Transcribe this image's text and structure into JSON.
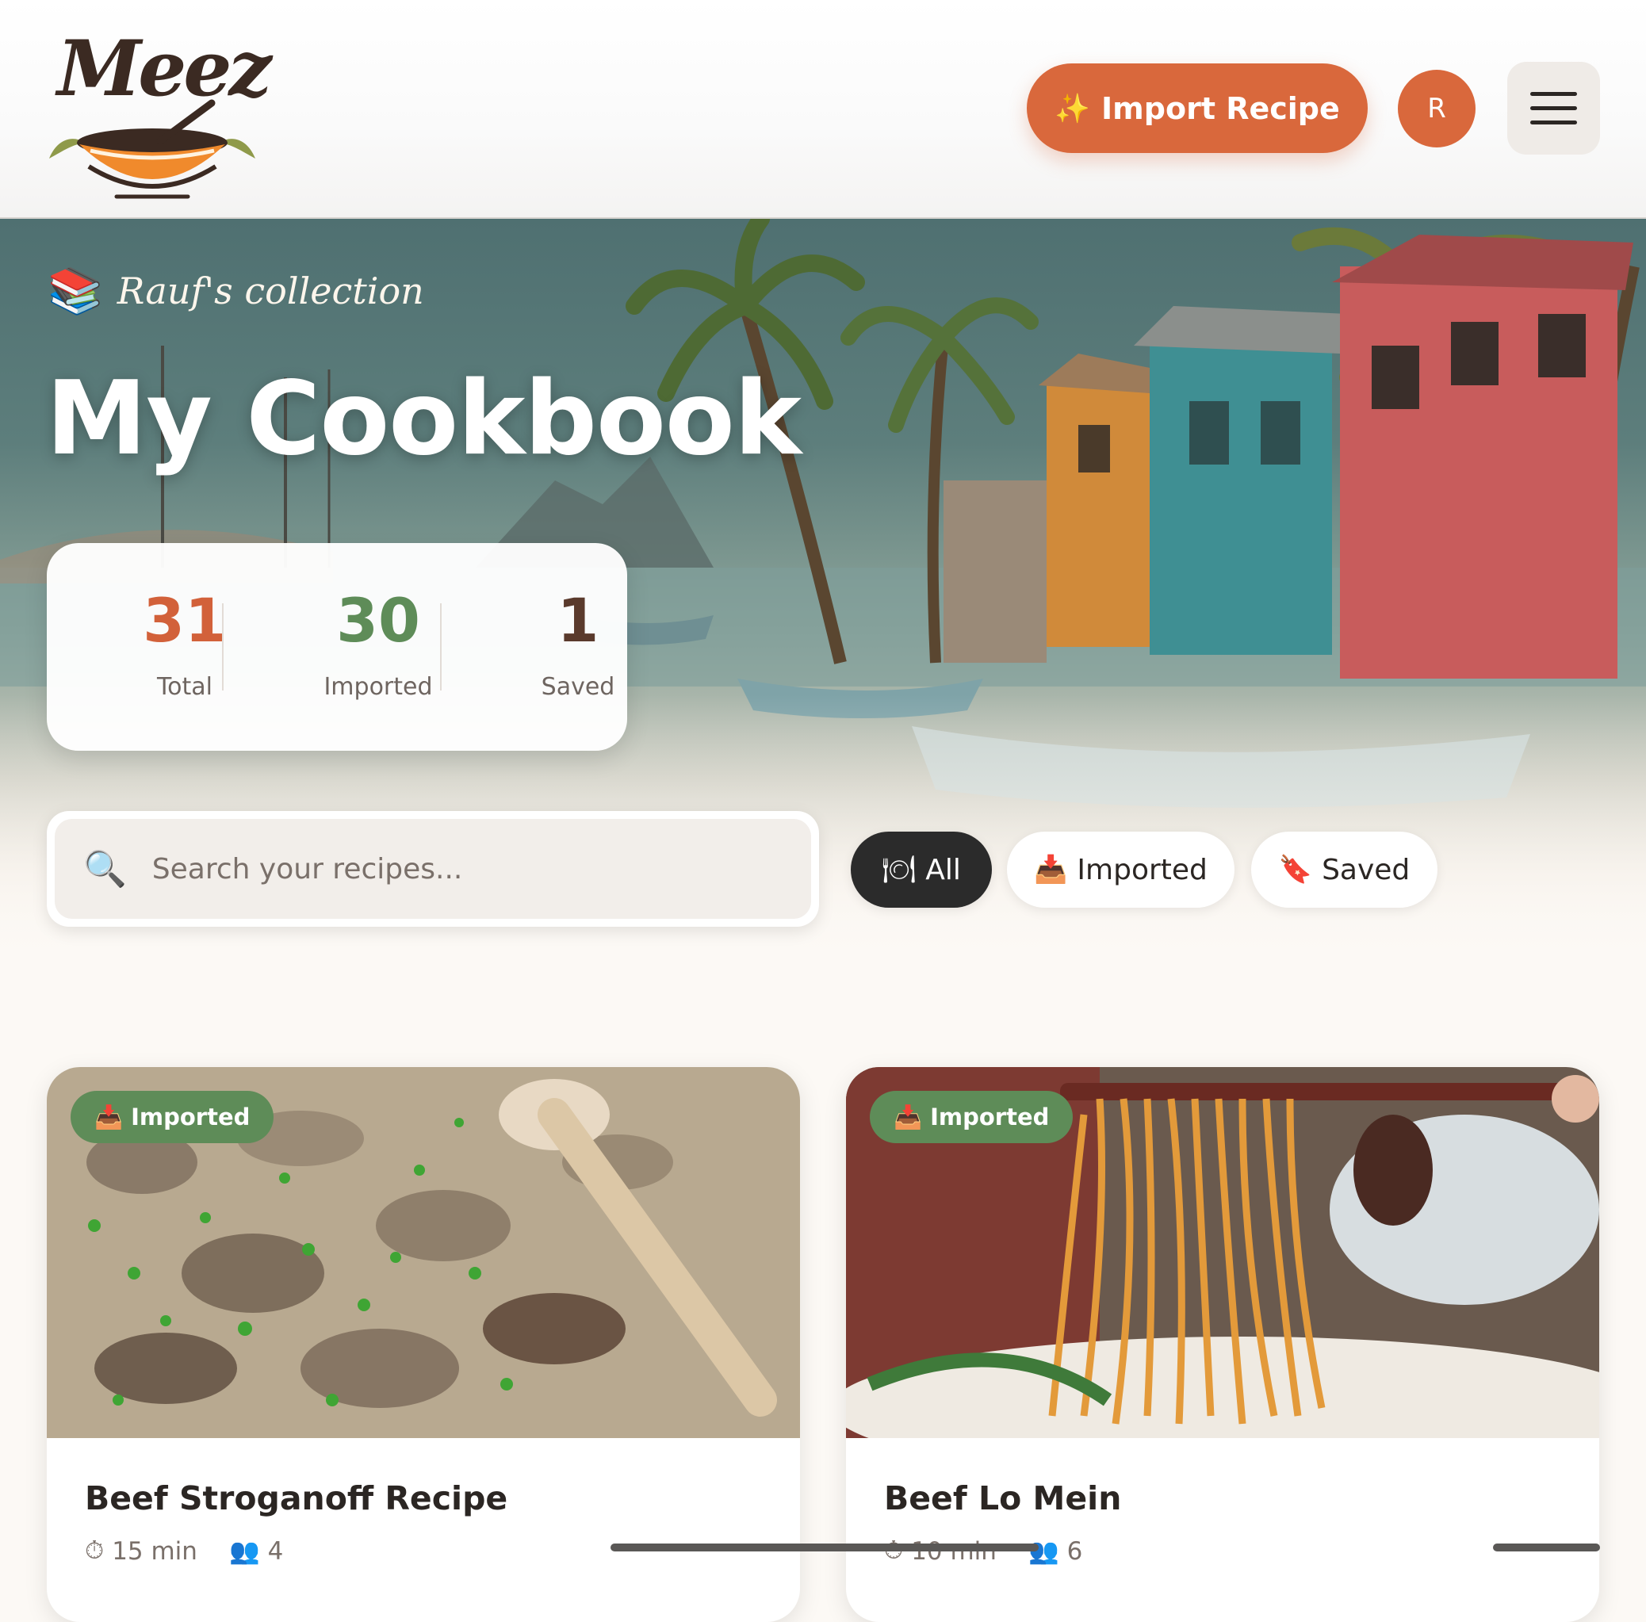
{
  "header": {
    "logo_text": "Meez",
    "import_button": "Import Recipe",
    "import_icon": "sparkles-icon",
    "avatar_initial": "R",
    "menu_icon": "hamburger-menu-icon"
  },
  "hero": {
    "collection_label": "Rauf's collection",
    "collection_icon": "books-icon",
    "title": "My Cookbook"
  },
  "stats": [
    {
      "value": "31",
      "label": "Total",
      "color": "#d2613a"
    },
    {
      "value": "30",
      "label": "Imported",
      "color": "#5e8c58"
    },
    {
      "value": "1",
      "label": "Saved",
      "color": "#5a3a2c"
    }
  ],
  "search": {
    "placeholder": "Search your recipes...",
    "icon": "magnifier-icon"
  },
  "filters": [
    {
      "label": "All",
      "icon": "plate-icon",
      "active": true
    },
    {
      "label": "Imported",
      "icon": "inbox-tray-icon",
      "active": false
    },
    {
      "label": "Saved",
      "icon": "bookmark-icon",
      "active": false
    }
  ],
  "recipes": [
    {
      "badge": "Imported",
      "title": "Beef Stroganoff Recipe",
      "time": "15 min",
      "servings": "4"
    },
    {
      "badge": "Imported",
      "title": "Beef Lo Mein",
      "time": "10 min",
      "servings": "6"
    }
  ],
  "colors": {
    "accent": "#d9683c",
    "imported_green": "#5e8c58",
    "active_filter": "#2b2b2b",
    "background": "#fcf9f5"
  }
}
